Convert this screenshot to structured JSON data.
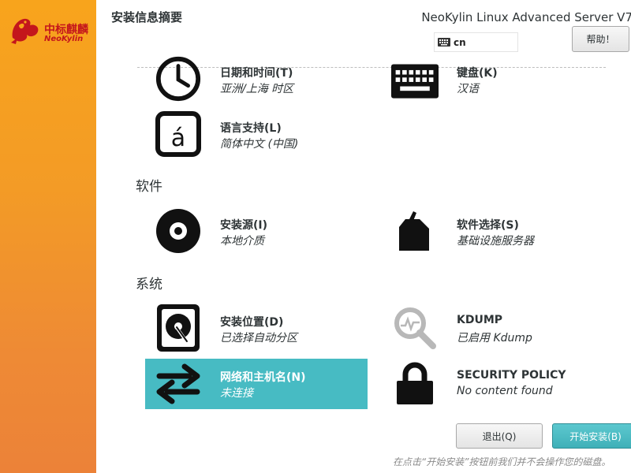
{
  "sidebar": {
    "brand_cn": "中标麒麟",
    "brand_en": "NeoKylin"
  },
  "header": {
    "title": "安装信息摘要",
    "product": "NeoKylin Linux Advanced Server V7",
    "keyboard_layout": "cn",
    "help_label": "帮助！"
  },
  "sections": {
    "software": "软件",
    "system": "系统"
  },
  "spokes": {
    "datetime": {
      "title": "日期和时间(T)",
      "status": "亚洲/上海 时区",
      "icon": "clock-icon"
    },
    "keyboard": {
      "title": "键盘(K)",
      "status": "汉语",
      "icon": "keyboard-icon"
    },
    "language": {
      "title": "语言支持(L)",
      "status": "简体中文 (中国)",
      "icon": "language-icon"
    },
    "source": {
      "title": "安装源(I)",
      "status": "本地介质",
      "icon": "disc-icon"
    },
    "software": {
      "title": "软件选择(S)",
      "status": "基础设施服务器",
      "icon": "package-icon"
    },
    "destination": {
      "title": "安装位置(D)",
      "status": "已选择自动分区",
      "icon": "harddisk-icon"
    },
    "kdump": {
      "title": "KDUMP",
      "status": "已启用 Kdump",
      "icon": "kdump-icon"
    },
    "network": {
      "title": "网络和主机名(N)",
      "status": "未连接",
      "icon": "network-icon"
    },
    "security": {
      "title": "SECURITY POLICY",
      "status": "No content found",
      "icon": "lock-icon"
    }
  },
  "footer": {
    "quit_label": "退出(Q)",
    "begin_label": "开始安装(B)",
    "note": "在点击“开始安装”按钮前我们并不会操作您的磁盘。"
  },
  "colors": {
    "sidebar_top": "#f8a41c",
    "sidebar_bottom": "#ec8238",
    "selected": "#47bbc3",
    "brand_red": "#c4161c"
  }
}
